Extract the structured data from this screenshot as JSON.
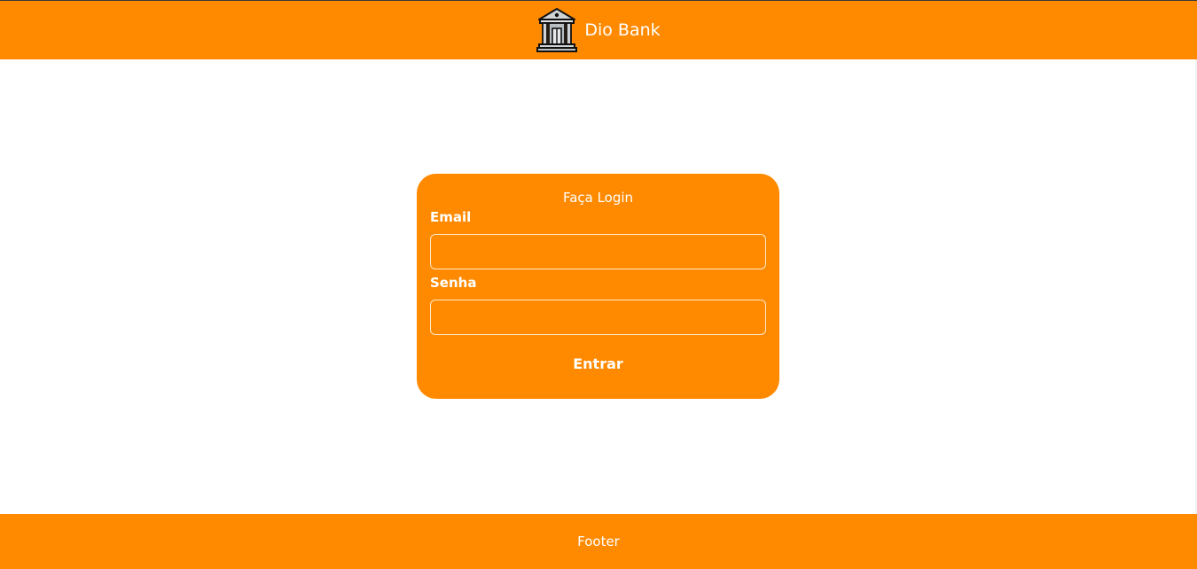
{
  "header": {
    "logo_icon": "bank-building-icon",
    "brand_name": "Dio Bank",
    "background_color": "#ff8a00"
  },
  "login": {
    "title": "Faça Login",
    "email_label": "Email",
    "email_value": "",
    "password_label": "Senha",
    "password_value": "",
    "submit_label": "Entrar"
  },
  "footer": {
    "text": "Footer"
  },
  "colors": {
    "accent": "#ff8a00",
    "text_on_accent": "#ffffff",
    "background": "#ffffff"
  }
}
